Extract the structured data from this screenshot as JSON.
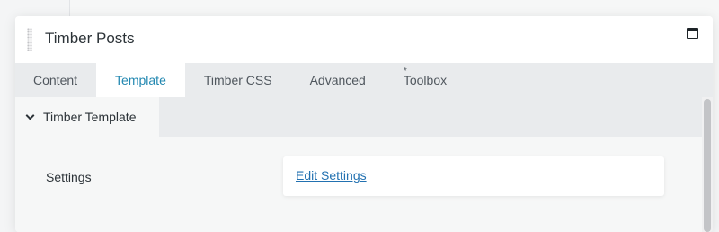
{
  "panel": {
    "title": "Timber Posts"
  },
  "tabs": [
    {
      "label": "Content",
      "active": false
    },
    {
      "label": "Template",
      "active": true
    },
    {
      "label": "Timber CSS",
      "active": false
    },
    {
      "label": "Advanced",
      "active": false
    },
    {
      "label": "Toolbox",
      "marker": "*",
      "active": false
    }
  ],
  "section": {
    "title": "Timber Template",
    "expanded": true
  },
  "settings": {
    "label": "Settings",
    "link_label": "Edit Settings"
  },
  "colors": {
    "accent": "#2388b1",
    "link": "#2271b1"
  },
  "icons": {
    "drag": "drag-handle-icon",
    "maximize": "maximize-icon",
    "chevron": "chevron-down-icon"
  }
}
